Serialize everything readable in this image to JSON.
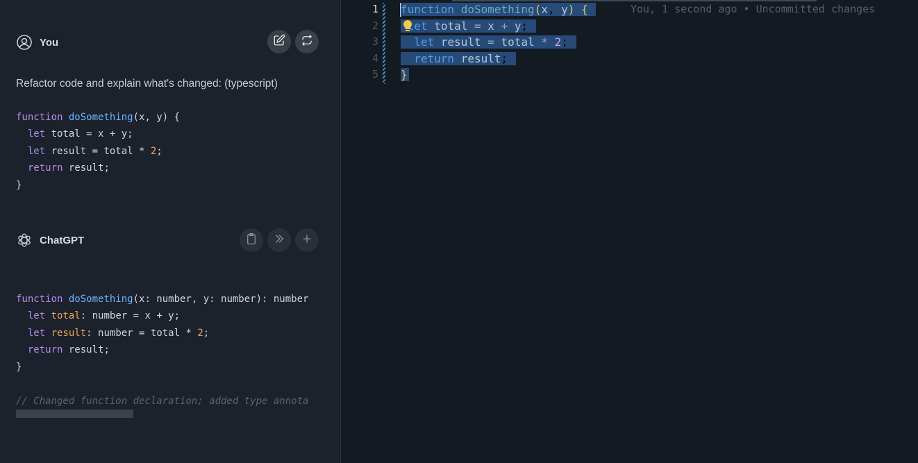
{
  "chat": {
    "user": {
      "name": "You",
      "prompt": "Refactor code and explain what's changed:  (typescript)",
      "code": [
        "function doSomething(x, y) {",
        "  let total = x + y;",
        "  let result = total * 2;",
        "  return result;",
        "}"
      ]
    },
    "assistant": {
      "name": "ChatGPT",
      "code": [
        "function doSomething(x: number, y: number): number",
        "  let total: number = x + y;",
        "  let result: number = total * 2;",
        "  return result;",
        "}"
      ],
      "comment": "// Changed function declaration; added type annota"
    }
  },
  "editor": {
    "line_numbers": [
      "1",
      "2",
      "3",
      "4",
      "5"
    ],
    "active_line": 1,
    "blame": "You, 1 second ago • Uncommitted changes",
    "lines": [
      "function doSomething(x, y) {",
      "  let total = x + y;",
      "  let result = total * 2;",
      "  return result;",
      "}"
    ]
  },
  "icons": {
    "user": "user-circle-icon",
    "edit": "edit-icon",
    "regenerate": "repeat-icon",
    "assistant": "openai-logo-icon",
    "copy": "clipboard-icon",
    "insert": "chevrons-right-icon",
    "add": "plus-icon",
    "hint": "lightbulb-icon"
  },
  "colors": {
    "selection": "#264b78",
    "keyword": "#5c9ae6",
    "bracket": "#e8c84a",
    "lightbulb": "#f2c94c"
  }
}
